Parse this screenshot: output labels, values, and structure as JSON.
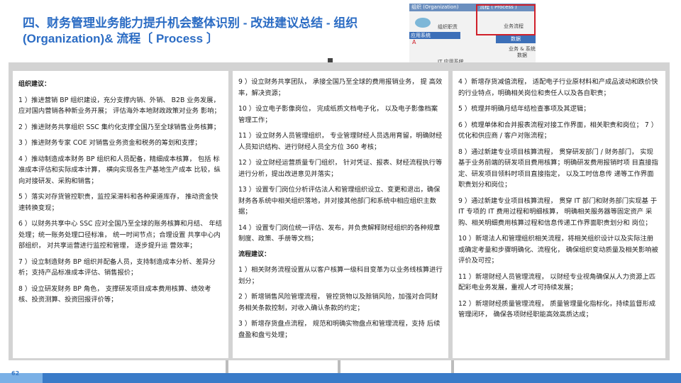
{
  "title": {
    "line1": "四、财务管理业务能力提升机会整体识别 - 改进建议总结  - 组织",
    "line2": "(Organization)& 流程〔 Process 〕"
  },
  "thumbnail": {
    "org_header": "组织 (Organization)",
    "proc_header": "流程 ( Process )",
    "org_duty": "组织职责",
    "app_system": "应用系统",
    "business_flow": "业务流程",
    "data": "数据",
    "business_system_data": "业务 & 系统\n数据",
    "it_app_system": "IT 应用系统",
    "tag": "A"
  },
  "columns": [
    {
      "section": "组织建议：",
      "items": [
        "1 ）推进营销 BP 组织建设，充分支撑内销、外销、   B2B 业务发展，  应对国内营销各种新业务开展；  评估海外本地财政政策对业务        影响；",
        "2 ）推进财务共享组织 SSC 集约化支撑全国乃至全球销售业务核算；",
        "3 ）推进财务专家 COE 对销售业务资金和税务的筹划和支撑；",
        "4 ）推动制造成本财务 BP 组织和人员配备，精细成本核算，  包括    标准成本评估和实际成本计算，  横向实现各生产基地生产成本        比较，纵向对接研发、采购和销售；",
        "5 ）落实对存货管控职责，监控呆滞料和各种渠道库存，  推动资金快速转换变现；",
        "6 ）以财务共享中心 SSC 应对全国乃至全球的账务核算和月结、    年结处理；统一账务处理口径标准，  统一时间节点；合理设置    共享中心内部组织，  对共享运营进行监控和管理，  逐步提升运          营效率；",
        "7 ）设立制造财务 BP 组织并配备人员，支持制造成本分析、差异分析；支持产品标准成本评估、销售报价；",
        "8 ）设立研发财务 BP 角色，  支撑研发项目成本费用核算、绩效考核、投资测算、投资回报评价等；"
      ]
    },
    {
      "section": "",
      "items": [
        "9 ）设立财务共享团队，  承接全国乃至全球的费用报销业务，  提   高效率，解决资源；",
        "10 ）设立电子影像岗位，  完成纸质文档电子化，  以及电子影像档案管理工作；",
        "11 ）设立财务人员管理组织，  专业管理财经人员选用育留，明确财经人员知识结构、进行财经人员全方位 360 考核；",
        "12 ）设立财经运营质量专门组织，  针对凭证、报表、财经流程执行等进行分析，提出改进意见并落实；",
        "13 ）设置专门岗位分析评估法人和管理组织设立、变更和退出，确保财务各系统中相关组织落地，并对接其他部门和系统中相应组织主数据；",
        "14 ）设置专门岗位统一评估、发布，并负责解释财经组织的各种规章制度、政策、手册等文档；"
      ],
      "section2": "流程建议：",
      "items2": [
        "1 ）相关财务流程设置从以客户核算一级科目变革为以业务线核算进行划分；",
        "2 ）新增销售风险管理流程，  管控货物以及赊销风险，加强对合同财务相关条款控制，对收入确认条款的约定；",
        "3 ）新增存货盘点流程，  规范和明确实物盘点和管理流程，支持  后续盘盈和盘亏处理；"
      ]
    },
    {
      "section": "",
      "items": [
        "4 ）新增存货减值流程，  适配电子行业原材料和产成品波动和跌价快的行业特点，明确相关岗位和责任人以及各自职责；",
        "5 ）梳理并明确月结年结检查事项及其逻辑；",
        "6 ）梳理单体和合并报表流程对接工作界面，相关职责和岗位；  7 ）优化和供应商 / 客户对账流程；",
        "8 ）通过新建专业项目核算流程，  贯穿研发部门 / 财务部门，  实现基于业务前端的研发项目费用核算；明确研发费用报销时项        目直接指定、研发项目领料时项目直接指定，  以及工时信息传        递等工作界面职责划分和岗位；",
        "9 ）通过新建专业项目核算流程，  贯穿 IT 部门和财务部门实现基    于 IT 专项的 IT 费用过程和明细核算，  明确相关服务器等固定资产    采购、相关明细费用核算过程和信息传递工作界面职责划分和        岗位；",
        "10 ）新增法人和管理组织相关流程，将相关组织设计以及实际注册或确定考量和步骤明确化、流程化，  确保组织变动质量及相关影响被评价及可控；",
        "11 ）新增财经人员管理流程，  以财经专业视角确保从人力资源上匹配彩电业务发展，重视人才可持续发展；",
        "12 ）新增财经质量管理流程，  质量管理量化指标化，持续监督形成管理闭环，  确保各项财经职能高效高质达成；"
      ]
    }
  ],
  "page_number": "62",
  "colors": {
    "title": "#2b6cc4",
    "card_bg": "#d3d3d3",
    "bottom_bar": "#3a7bc8",
    "frame_red": "#d0202a"
  }
}
